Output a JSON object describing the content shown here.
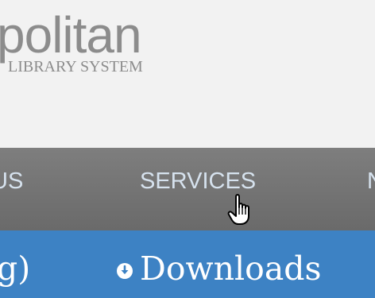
{
  "header": {
    "logo_word": "politan",
    "logo_sub": "LIBRARY SYSTEM"
  },
  "nav": {
    "items": [
      {
        "label": "US"
      },
      {
        "label": "SERVICES"
      },
      {
        "label": "N"
      }
    ]
  },
  "tabs": {
    "left_fragment": "g)",
    "downloads_label": "Downloads",
    "downloads_icon": "download-circle-icon"
  },
  "colors": {
    "header_bg": "#f2f2f2",
    "nav_bg": "#737373",
    "nav_text": "#d6e2ee",
    "tab_bar_bg": "#3d82c4",
    "tab_text": "#ffffff"
  }
}
